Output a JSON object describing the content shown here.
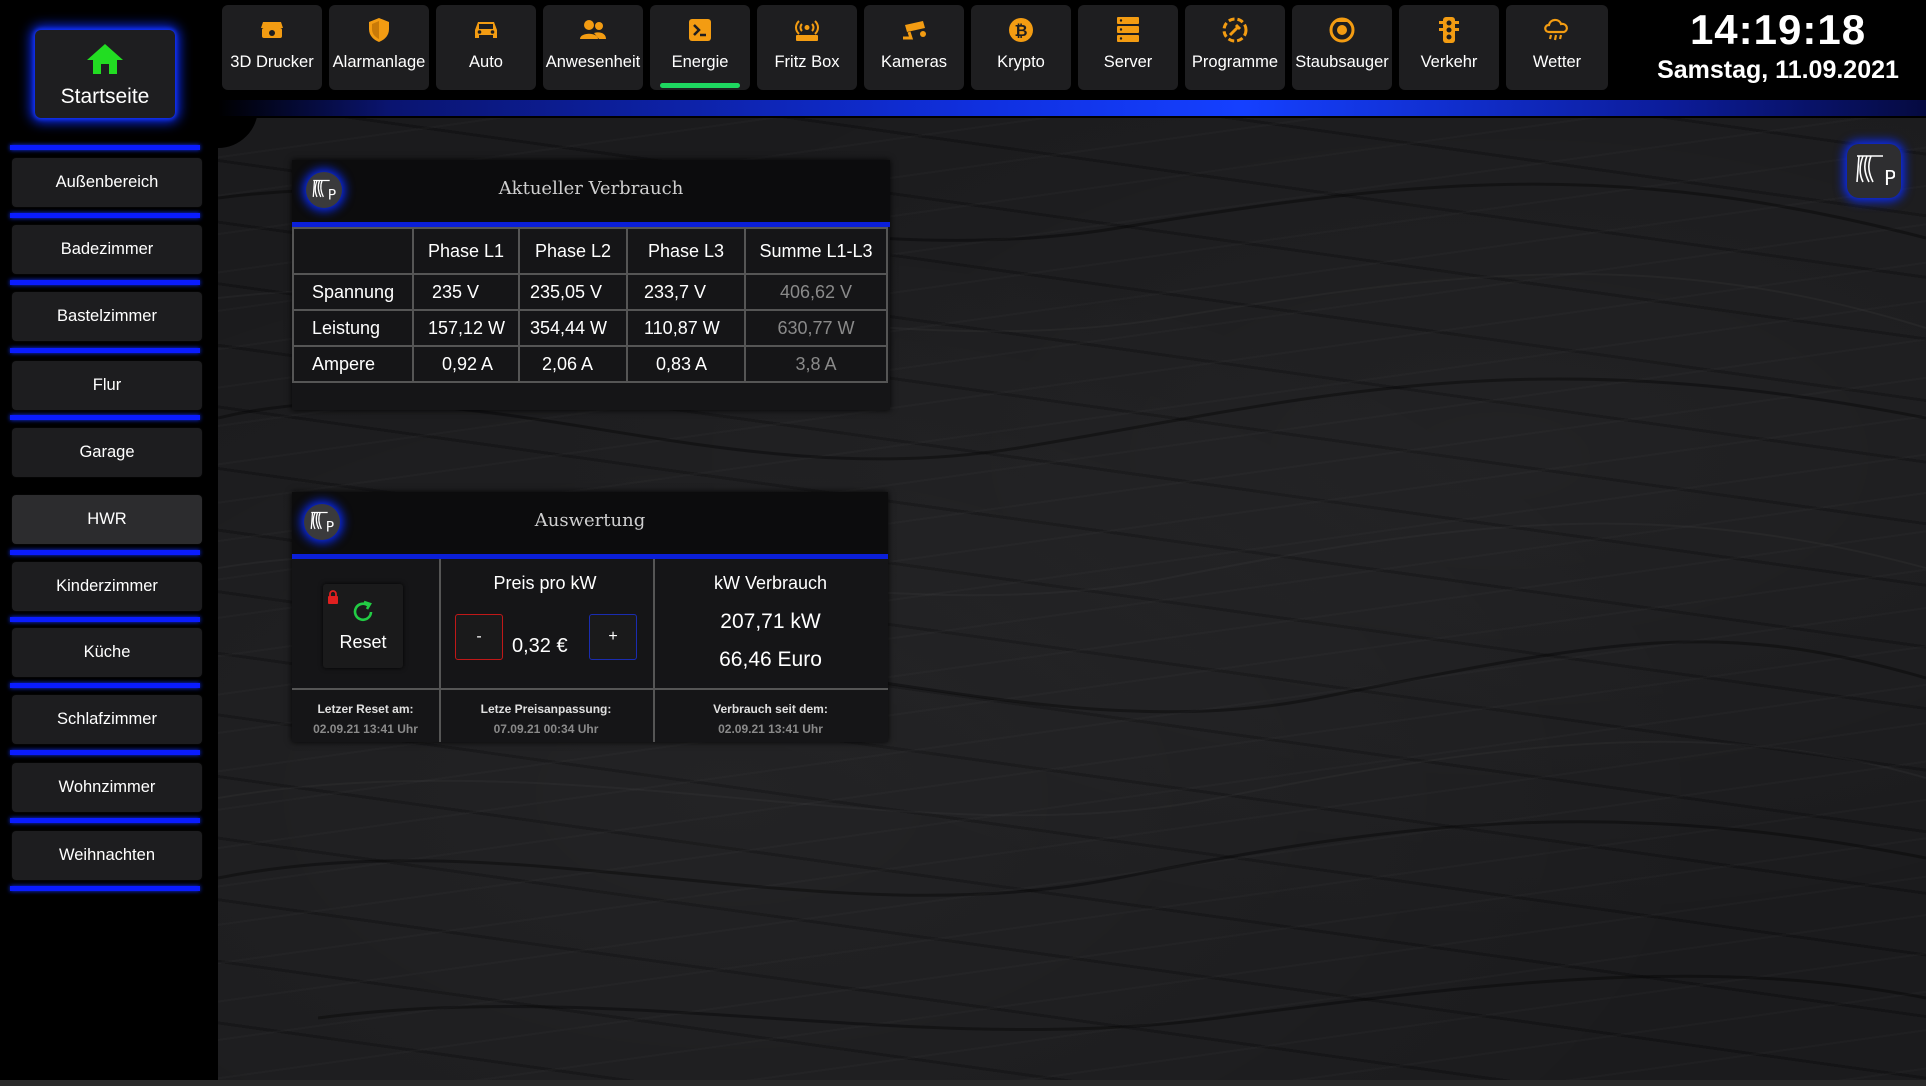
{
  "home": {
    "label": "Startseite",
    "icon": "home-icon",
    "icon_color": "#22dd22"
  },
  "nav_tabs": [
    {
      "label": "3D Drucker",
      "icon": "printer-3d-icon"
    },
    {
      "label": "Alarmanlage",
      "icon": "shield-icon"
    },
    {
      "label": "Auto",
      "icon": "car-icon"
    },
    {
      "label": "Anwesenheit",
      "icon": "users-icon"
    },
    {
      "label": "Energie",
      "icon": "energy-icon",
      "active": true
    },
    {
      "label": "Fritz Box",
      "icon": "router-icon"
    },
    {
      "label": "Kameras",
      "icon": "camera-icon"
    },
    {
      "label": "Krypto",
      "icon": "bitcoin-icon"
    },
    {
      "label": "Server",
      "icon": "server-icon"
    },
    {
      "label": "Programme",
      "icon": "programs-icon"
    },
    {
      "label": "Staubsauger",
      "icon": "vacuum-icon"
    },
    {
      "label": "Verkehr",
      "icon": "traffic-light-icon"
    },
    {
      "label": "Wetter",
      "icon": "weather-icon"
    }
  ],
  "clock": {
    "time": "14:19:18",
    "date": "Samstag, 11.09.2021"
  },
  "rooms": [
    {
      "label": "Außenbereich"
    },
    {
      "label": "Badezimmer"
    },
    {
      "label": "Bastelzimmer"
    },
    {
      "label": "Flur"
    },
    {
      "label": "Garage"
    },
    {
      "label": "HWR",
      "active": true
    },
    {
      "label": "Kinderzimmer"
    },
    {
      "label": "Küche"
    },
    {
      "label": "Schlafzimmer"
    },
    {
      "label": "Wohnzimmer"
    },
    {
      "label": "Weihnachten"
    }
  ],
  "consumption": {
    "title": "Aktueller Verbrauch",
    "headers": [
      "",
      "Phase L1",
      "Phase L2",
      "Phase L3",
      "Summe L1-L3"
    ],
    "rows": [
      {
        "label": "Spannung",
        "l1": "235 V",
        "l2": "235,05 V",
        "l3": "233,7 V",
        "sum": "406,62 V"
      },
      {
        "label": "Leistung",
        "l1": "157,12 W",
        "l2": "354,44 W",
        "l3": "110,87 W",
        "sum": "630,77 W"
      },
      {
        "label": "Ampere",
        "l1": "0,92 A",
        "l2": "2,06 A",
        "l3": "0,83 A",
        "sum": "3,8 A"
      }
    ]
  },
  "evaluation": {
    "title": "Auswertung",
    "reset_label": "Reset",
    "price_label": "Preis pro kW",
    "price_value": "0,32 €",
    "minus_label": "-",
    "plus_label": "+",
    "usage_label": "kW Verbrauch",
    "usage_kw": "207,71 kW",
    "usage_euro": "66,46 Euro",
    "last_reset_label": "Letzer Reset am:",
    "last_reset_value": "02.09.21 13:41 Uhr",
    "last_price_label": "Letze Preisanpassung:",
    "last_price_value": "07.09.21 00:34 Uhr",
    "since_label": "Verbrauch seit dem:",
    "since_value": "02.09.21 13:41 Uhr"
  },
  "colors": {
    "accent_orange": "#f39c12",
    "glow_blue": "#0a1cff",
    "active_green": "#1ed760"
  }
}
